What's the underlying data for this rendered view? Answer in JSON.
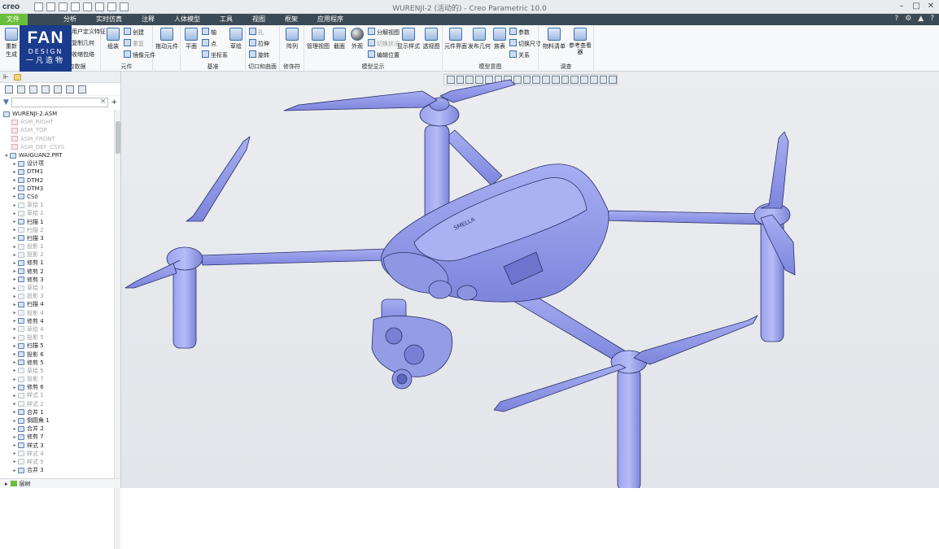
{
  "app": {
    "logo": "creo",
    "window_title": "WURENJI-2 (活动的) - Creo Parametric 10.0"
  },
  "menubar": {
    "file": "文件",
    "items": [
      "分析",
      "实时仿真",
      "注释",
      "人体模型",
      "工具",
      "视图",
      "框架",
      "应用程序"
    ]
  },
  "brand": {
    "fan": "FAN",
    "design": "DESIGN",
    "cn": "一凡造物"
  },
  "ribbon": {
    "g0": {
      "items": [
        "重新生成",
        "用户定义特征",
        "复制几何",
        "收缩包络"
      ],
      "label": "获取数据"
    },
    "g1": {
      "items": [
        "组装",
        "创建",
        "重复",
        "镜像元件"
      ],
      "label": "元件"
    },
    "g2": {
      "items": [
        "拖动元件"
      ]
    },
    "g3": {
      "items": [
        "平面",
        "轴",
        "点",
        "坐标系",
        "草绘"
      ],
      "label": "基准"
    },
    "g4": {
      "items": [
        "孔",
        "拉伸",
        "旋转"
      ],
      "label": "切口和曲面"
    },
    "g5": {
      "items": [
        "阵列"
      ],
      "label": "修饰符"
    },
    "g6": {
      "items": [
        "管理视图",
        "截面",
        "外观",
        "分解视图",
        "切换状况",
        "编辑位置",
        "显示样式",
        "透视图"
      ],
      "label": "模型显示"
    },
    "g7": {
      "items": [
        "元件界面",
        "发布几何",
        "族表",
        "参数",
        "切换尺寸",
        "关系"
      ],
      "label": "模型意图"
    },
    "g8": {
      "items": [
        "物料清单",
        "参考查看器"
      ],
      "label": "调查"
    }
  },
  "tree": {
    "root": "WURENJI-2.ASM",
    "items": [
      {
        "label": "ASM_RIGHT",
        "kind": "datum"
      },
      {
        "label": "ASM_TOP",
        "kind": "datum"
      },
      {
        "label": "ASM_FRONT",
        "kind": "datum"
      },
      {
        "label": "ASM_DEF_CSYS",
        "kind": "datum"
      },
      {
        "label": "WAIGUAN2.PRT",
        "kind": "part"
      },
      {
        "label": "设计项",
        "kind": "normal"
      },
      {
        "label": "DTM1",
        "kind": "normal"
      },
      {
        "label": "DTM2",
        "kind": "normal"
      },
      {
        "label": "DTM3",
        "kind": "normal"
      },
      {
        "label": "CS0",
        "kind": "normal"
      },
      {
        "label": "草绘 1",
        "kind": "dim"
      },
      {
        "label": "草绘 2",
        "kind": "dim"
      },
      {
        "label": "扫描 1",
        "kind": "normal"
      },
      {
        "label": "扫描 2",
        "kind": "dim"
      },
      {
        "label": "扫描 3",
        "kind": "normal"
      },
      {
        "label": "投影 1",
        "kind": "dim"
      },
      {
        "label": "投影 2",
        "kind": "dim"
      },
      {
        "label": "修剪 1",
        "kind": "normal"
      },
      {
        "label": "修剪 2",
        "kind": "normal"
      },
      {
        "label": "修剪 3",
        "kind": "normal"
      },
      {
        "label": "草绘 3",
        "kind": "dim"
      },
      {
        "label": "投影 3",
        "kind": "dim"
      },
      {
        "label": "扫描 4",
        "kind": "normal"
      },
      {
        "label": "投影 4",
        "kind": "dim"
      },
      {
        "label": "修剪 4",
        "kind": "normal"
      },
      {
        "label": "草绘 4",
        "kind": "dim"
      },
      {
        "label": "投影 5",
        "kind": "dim"
      },
      {
        "label": "扫描 5",
        "kind": "normal"
      },
      {
        "label": "投影 6",
        "kind": "normal"
      },
      {
        "label": "修剪 5",
        "kind": "normal"
      },
      {
        "label": "草绘 5",
        "kind": "dim"
      },
      {
        "label": "投影 7",
        "kind": "dim"
      },
      {
        "label": "修剪 6",
        "kind": "normal"
      },
      {
        "label": "样式 1",
        "kind": "dim"
      },
      {
        "label": "样式 2",
        "kind": "dim"
      },
      {
        "label": "合并 1",
        "kind": "normal"
      },
      {
        "label": "倒圆角 1",
        "kind": "normal"
      },
      {
        "label": "合并 2",
        "kind": "normal"
      },
      {
        "label": "修剪 7",
        "kind": "normal"
      },
      {
        "label": "样式 3",
        "kind": "normal"
      },
      {
        "label": "样式 4",
        "kind": "dim"
      },
      {
        "label": "样式 5",
        "kind": "dim"
      },
      {
        "label": "合并 3",
        "kind": "normal"
      }
    ],
    "footer": "层树"
  },
  "model": {
    "nameplate": "SMELLA"
  },
  "colors": {
    "menubar": "#3c4a55",
    "file_tab": "#6cbf3c",
    "brand": "#1b3c8c",
    "model": "#8e96e6"
  }
}
